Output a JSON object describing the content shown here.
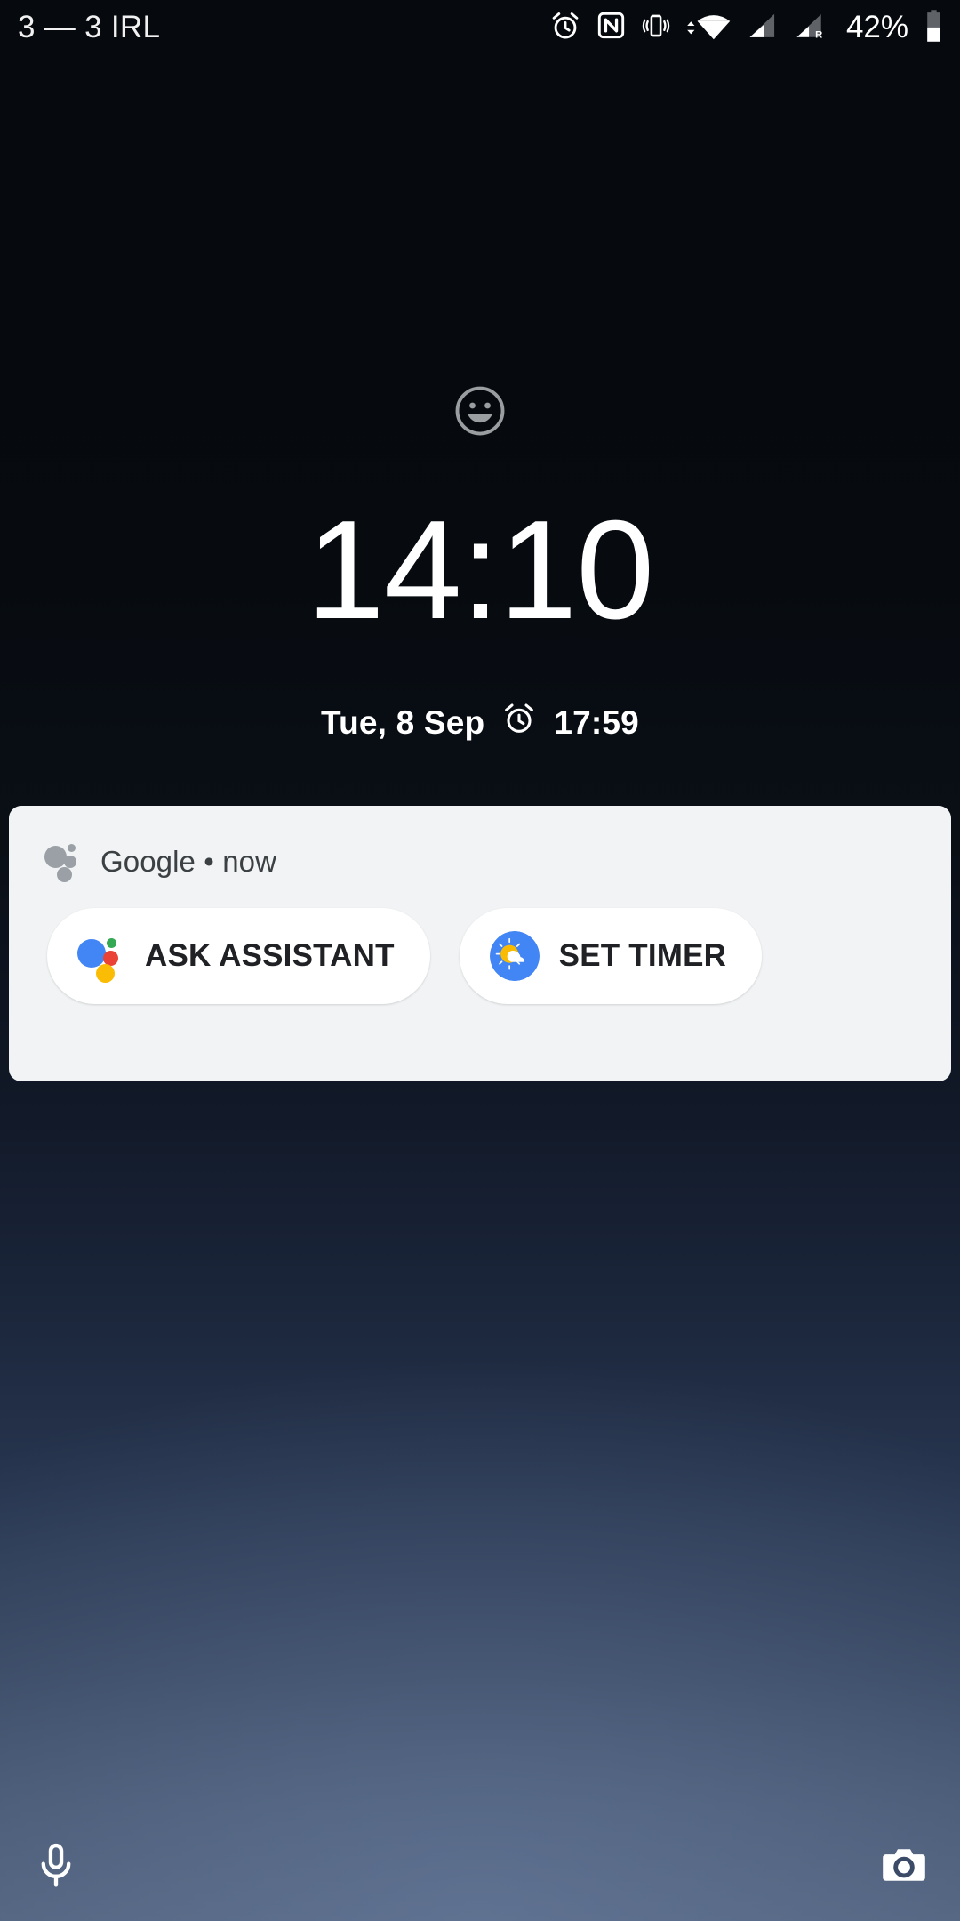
{
  "status_bar": {
    "carrier_label": "3 — 3 IRL",
    "battery_percent": "42%",
    "icons": [
      {
        "name": "alarm-icon",
        "label": "alarm set"
      },
      {
        "name": "nfc-icon",
        "label": "NFC on"
      },
      {
        "name": "vibrate-icon",
        "label": "ringer vibrate"
      },
      {
        "name": "wifi-icon",
        "label": "wifi connected"
      },
      {
        "name": "cellular-signal-icon",
        "label": "signal sim 1"
      },
      {
        "name": "cellular-signal-roaming-icon",
        "label": "signal sim 2 roaming"
      },
      {
        "name": "battery-icon",
        "label": "battery 42 percent"
      }
    ],
    "roaming_badge": "R"
  },
  "lockscreen": {
    "smiley_icon": "smiley-face-icon",
    "time": "14:10",
    "date": "Tue, 8 Sep",
    "alarm_icon": "alarm-icon",
    "next_alarm": "17:59"
  },
  "notification": {
    "app_icon": "google-assistant-icon",
    "app_line": "Google • now",
    "app_name": "Google",
    "separator": "•",
    "time_ago": "now",
    "card_bg": "#f1f3f4",
    "actions": [
      {
        "label": "ASK ASSISTANT",
        "icon": "google-assistant-icon",
        "icon_colors": {
          "blue": "#4285f4",
          "green": "#34a853",
          "red": "#ea4335",
          "yellow": "#fbbc05"
        }
      },
      {
        "label": "SET TIMER",
        "icon": "google-clock-icon",
        "icon_colors": {
          "disc": "#4285f4",
          "sun": "#fabb05",
          "cloud": "#ffffff"
        }
      }
    ]
  },
  "shortcuts": {
    "left": {
      "name": "microphone-shortcut",
      "icon": "microphone-icon"
    },
    "right": {
      "name": "camera-shortcut",
      "icon": "camera-icon"
    }
  },
  "colors": {
    "background_top": "#060a0e",
    "background_bottom": "#4e5f79",
    "text_primary": "#ffffff",
    "notification_text": "#3c4043",
    "chip_bg": "#ffffff"
  }
}
